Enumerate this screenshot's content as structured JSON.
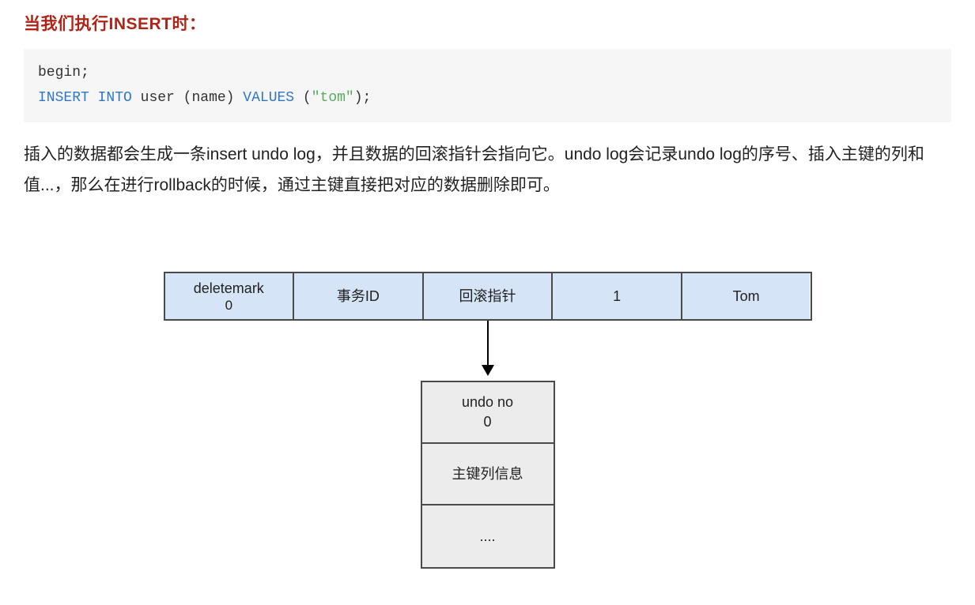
{
  "heading": "当我们执行INSERT时：",
  "code": {
    "line1": "begin;",
    "kw_insert": "INSERT",
    "kw_into": "INTO",
    "tbl": "user",
    "open_paren": " (name) ",
    "kw_values": "VALUES",
    "open2": " (",
    "str": "\"tom\"",
    "close": ");"
  },
  "paragraph": "插入的数据都会生成一条insert undo log，并且数据的回滚指针会指向它。undo log会记录undo log的序号、插入主键的列和值...，那么在进行rollback的时候，通过主键直接把对应的数据删除即可。",
  "diagram": {
    "row": [
      {
        "label": "deletemark",
        "sub": "0"
      },
      {
        "label": "事务ID"
      },
      {
        "label": "回滚指针"
      },
      {
        "label": "1"
      },
      {
        "label": "Tom"
      }
    ],
    "undo": [
      {
        "label": "undo no",
        "sub": "0"
      },
      {
        "label": "主键列信息"
      },
      {
        "label": "...."
      }
    ]
  }
}
